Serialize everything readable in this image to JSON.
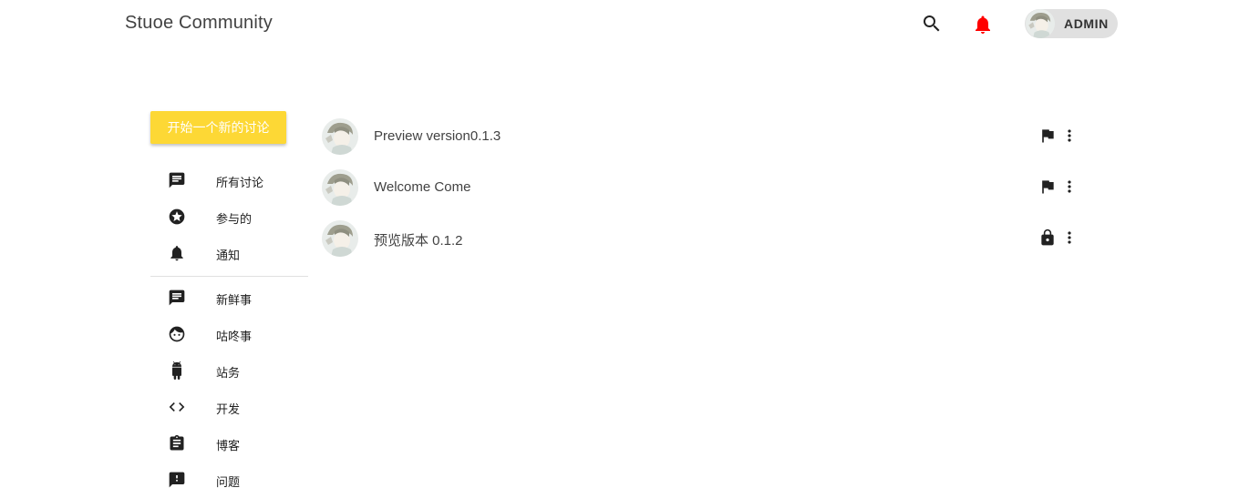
{
  "header": {
    "brand": "Stuoe Community",
    "username": "ADMIN",
    "notification_color": "#ff0000"
  },
  "sidebar": {
    "new_discussion_label": "开始一个新的讨论",
    "accent_color": "#fdd835",
    "primary_items": [
      {
        "label": "所有讨论",
        "icon": "forum-icon"
      },
      {
        "label": "参与的",
        "icon": "star-circle-icon"
      },
      {
        "label": "通知",
        "icon": "bell-icon"
      }
    ],
    "category_items": [
      {
        "label": "新鲜事",
        "icon": "message-icon"
      },
      {
        "label": "咕咚事",
        "icon": "face-icon"
      },
      {
        "label": "站务",
        "icon": "android-icon"
      },
      {
        "label": "开发",
        "icon": "code-icon"
      },
      {
        "label": "博客",
        "icon": "clipboard-icon"
      },
      {
        "label": "问题",
        "icon": "feedback-icon"
      }
    ]
  },
  "topics": [
    {
      "title": "Preview version0.1.3",
      "status_icon": "flag-icon"
    },
    {
      "title": "Welcome Come",
      "status_icon": "flag-icon"
    },
    {
      "title": "预览版本 0.1.2",
      "status_icon": "lock-icon"
    }
  ]
}
